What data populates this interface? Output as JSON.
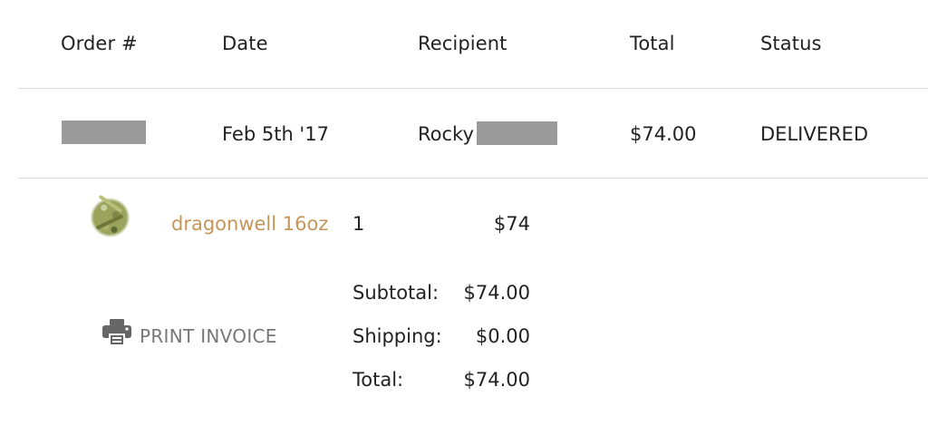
{
  "table": {
    "headers": {
      "order": "Order #",
      "date": "Date",
      "recipient": "Recipient",
      "total": "Total",
      "status": "Status"
    }
  },
  "order": {
    "date": "Feb 5th '17",
    "recipient_first": "Rocky",
    "total": "$74.00",
    "status": "DELIVERED"
  },
  "item": {
    "name": "dragonwell 16oz",
    "quantity": "1",
    "price": "$74"
  },
  "summary": {
    "subtotal_label": "Subtotal:",
    "subtotal_value": "$74.00",
    "shipping_label": "Shipping:",
    "shipping_value": "$0.00",
    "total_label": "Total:",
    "total_value": "$74.00"
  },
  "actions": {
    "print_label": "PRINT INVOICE",
    "print_icon": "printer-icon"
  },
  "colors": {
    "link": "#c5965a",
    "muted": "#777777",
    "redaction": "#9a9a9a",
    "rule": "#d9d9d9"
  }
}
